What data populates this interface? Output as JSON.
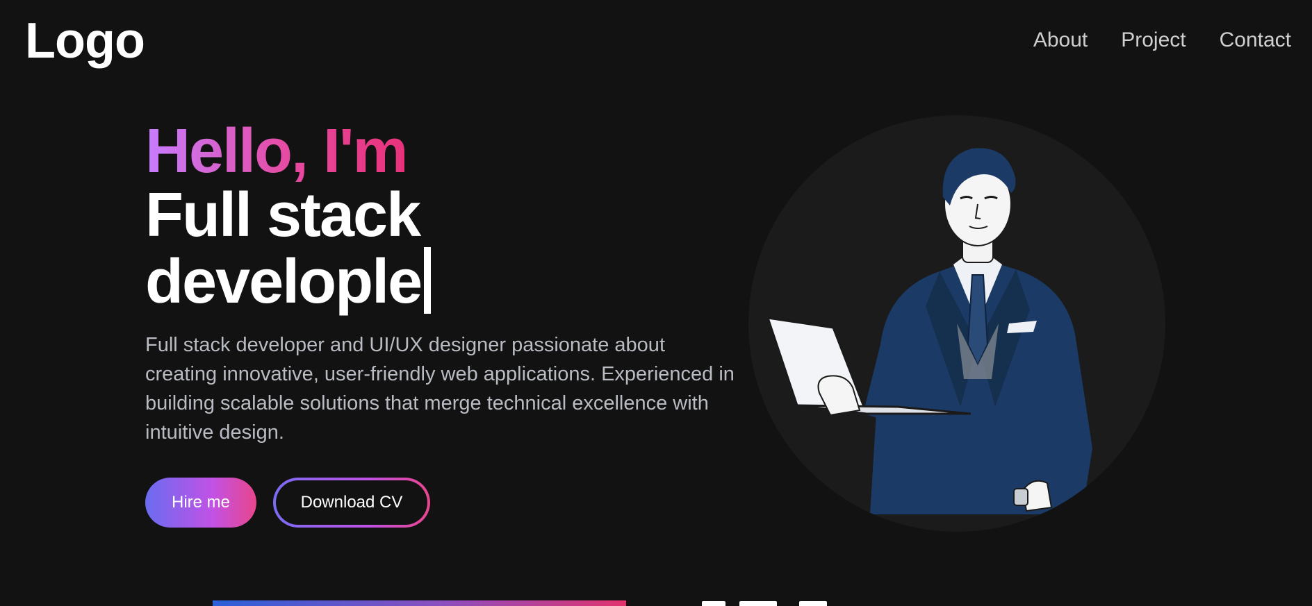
{
  "header": {
    "logo": "Logo",
    "nav": [
      {
        "label": "About"
      },
      {
        "label": "Project"
      },
      {
        "label": "Contact"
      }
    ]
  },
  "hero": {
    "greeting": "Hello, I'm",
    "role_line1": "Full stack",
    "role_line2": "develople",
    "intro": "Full stack developer and UI/UX designer passionate about creating innovative, user-friendly web applications. Experienced in building scalable solutions that merge technical excellence with intuitive design.",
    "buttons": {
      "hire": "Hire me",
      "cv": "Download CV"
    }
  },
  "colors": {
    "background": "#121212",
    "gradient_start": "#c77dff",
    "gradient_end": "#e8327a",
    "button_gradient_start": "#6a6cf0",
    "button_gradient_end": "#e8468c",
    "suit": "#1c3a66"
  },
  "portrait": {
    "icon": "developer-with-laptop-illustration"
  }
}
